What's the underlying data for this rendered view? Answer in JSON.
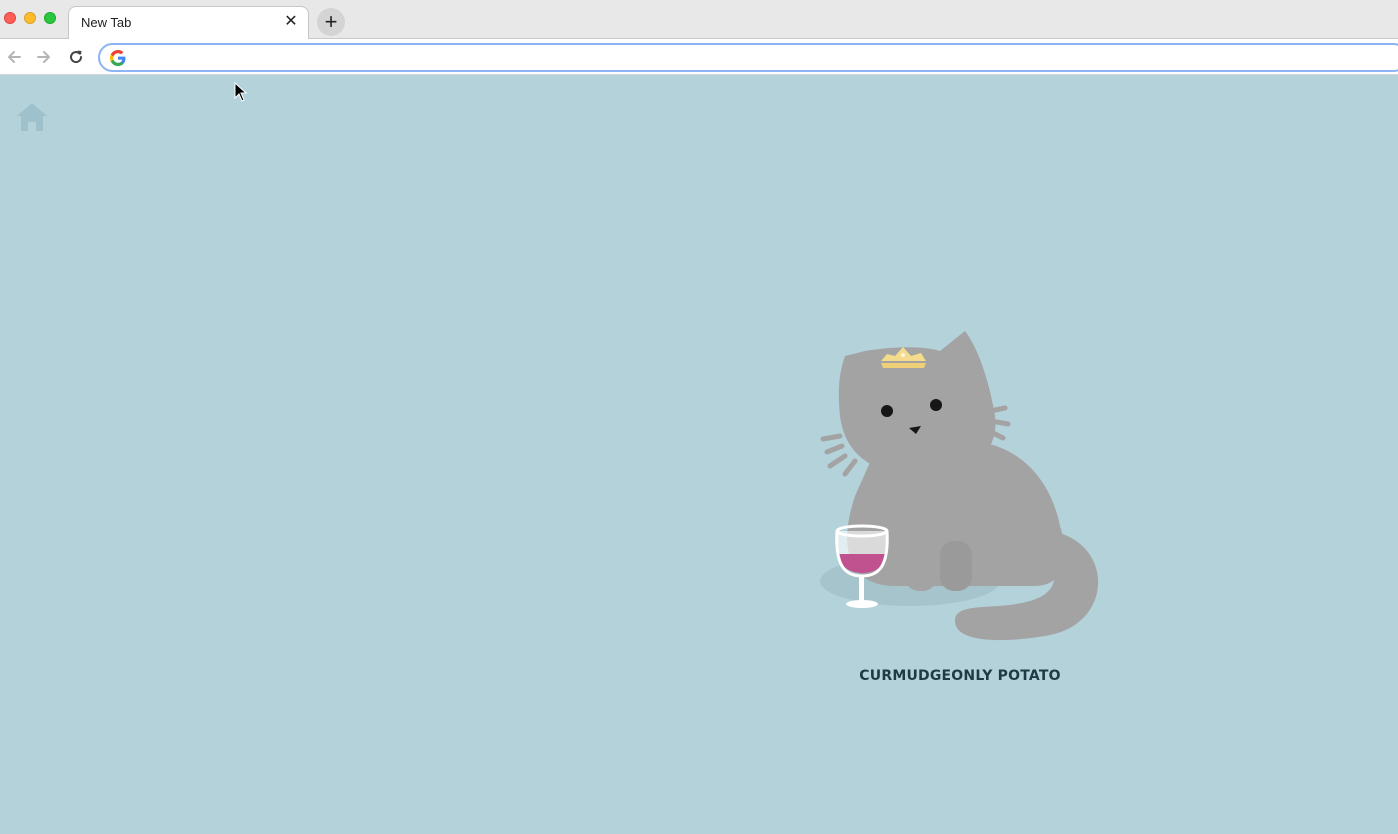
{
  "browser": {
    "tab": {
      "title": "New Tab",
      "close_label": "✕"
    },
    "new_tab_label": "+",
    "address_bar": {
      "value": "",
      "placeholder": ""
    }
  },
  "page": {
    "home_icon": "home-icon",
    "illustration": "cat-with-crown-and-wine-glass",
    "caption": "CURMUDGEONLY POTATO"
  },
  "colors": {
    "page_background": "#b4d2da",
    "cat_fur": "#a3a3a3",
    "crown": "#f4dc8c",
    "wine": "#c0528f",
    "caption_text": "#1f3a44"
  }
}
